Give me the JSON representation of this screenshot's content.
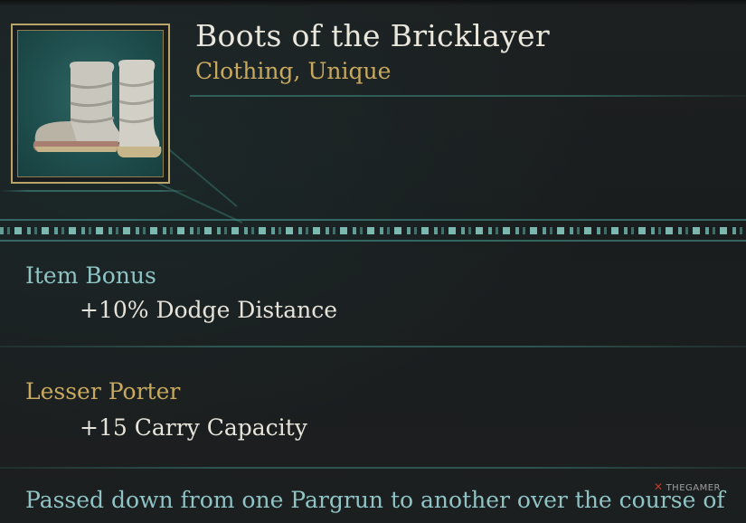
{
  "item": {
    "name": "Boots of the Bricklayer",
    "category": "Clothing, Unique",
    "icon": "boots-icon"
  },
  "sections": [
    {
      "heading": "Item Bonus",
      "value": "+10% Dodge Distance"
    },
    {
      "heading": "Lesser Porter",
      "value": "+15 Carry Capacity"
    }
  ],
  "lore": "Passed down from one Pargrun to another over the course of",
  "watermark": "THEGAMER",
  "colors": {
    "title": "#e9e6dc",
    "gold_accent": "#c8a95e",
    "teal_text": "#8fc3c4",
    "frame": "#b9a56a",
    "background": "#1b1e1f"
  }
}
